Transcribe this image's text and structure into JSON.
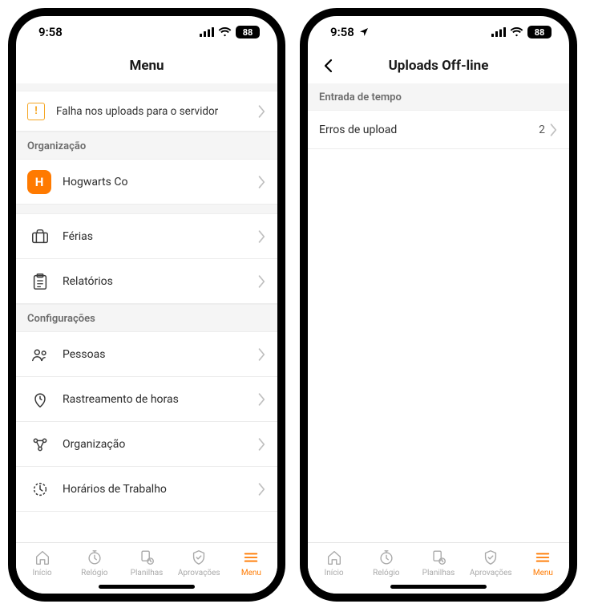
{
  "status": {
    "time": "9:58",
    "battery": "88"
  },
  "left": {
    "title": "Menu",
    "upload_warning": "Falha nos uploads para o servidor",
    "sections": {
      "org": {
        "header": "Organização",
        "org_initial": "H",
        "org_name": "Hogwarts Co",
        "ferias": "Férias",
        "relatorios": "Relatórios"
      },
      "config": {
        "header": "Configurações",
        "pessoas": "Pessoas",
        "rastreamento": "Rastreamento de horas",
        "organizacao": "Organização",
        "horarios": "Horários de Trabalho"
      }
    }
  },
  "right": {
    "title": "Uploads Off-line",
    "section_header": "Entrada de tempo",
    "row_label": "Erros de upload",
    "row_value": "2"
  },
  "tabs": {
    "inicio": "Início",
    "relogio": "Relógio",
    "planilhas": "Planilhas",
    "aprovacoes": "Aprovações",
    "menu": "Menu"
  }
}
